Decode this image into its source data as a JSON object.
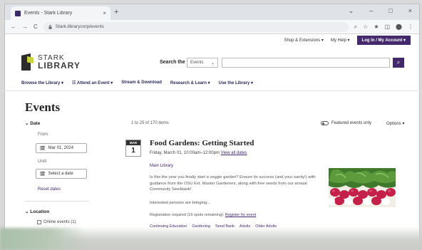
{
  "browser": {
    "tab_title": "Events - Stark Library",
    "tab_close": "×",
    "new_tab": "+",
    "win_controls": [
      "⌄",
      "–",
      "□",
      "×"
    ],
    "nav_buttons": [
      "←",
      "→",
      "C"
    ],
    "url": "Stark.librarycorp/events",
    "lock_icon": "lock-icon",
    "ext_icons": [
      "⌕",
      "☆",
      "★",
      "◫",
      "⬤",
      "⋮"
    ]
  },
  "utility": {
    "links": [
      "Shop & Extensions ▾",
      "My Help ▾"
    ],
    "login": "Log In / My Account ▾"
  },
  "logo": {
    "line1": "STARK",
    "line2": "LIBRARY"
  },
  "search": {
    "label": "Search the",
    "scope": "Events",
    "caret": "⌄",
    "button_icon": "⌕"
  },
  "nav": [
    "Browse the Library ▾",
    "☷ Attend an Event ▾",
    "Stream & Download",
    "Research & Learn ▾",
    "Use the Library ▾"
  ],
  "page": {
    "title": "Events",
    "results_count": "1 to 25 of 170 items",
    "featured_label": "Featured events only",
    "options_label": "Options ▾"
  },
  "facets": {
    "date_heading": "⌄  Date",
    "from_label": "From",
    "from_value": "Mar 01, 2024",
    "until_label": "Until",
    "until_value": "Select a date",
    "calendar_icon": "🗓",
    "reset": "Reset dates",
    "location_heading": "⌄  Location",
    "location_item": "Online events (1)"
  },
  "event": {
    "month": "MAR",
    "day": "1",
    "title": "Food Gardens: Getting Started",
    "when": "Friday, March 01, 10:00am–12:00pm",
    "when_link": "View all dates",
    "location": "Main Library",
    "description": "Is this the year you finally start a veggie garden? Ensure its success (and your sanity!) with guidance from the OSU Ext. Master Gardeners, along with free seeds from our annual Community Seedbank!",
    "interest": "Interested persons are bringing...",
    "registration": "Registration required (16 spots remaining):",
    "registration_link": "Register for event",
    "tags": [
      "Continuing Education",
      "Gardening",
      "Seed Bank",
      "Adults",
      "Older Adults"
    ]
  },
  "colors": {
    "brand_purple": "#43286b",
    "logo_dark": "#2d2a2b",
    "logo_lime": "#c9d534"
  }
}
